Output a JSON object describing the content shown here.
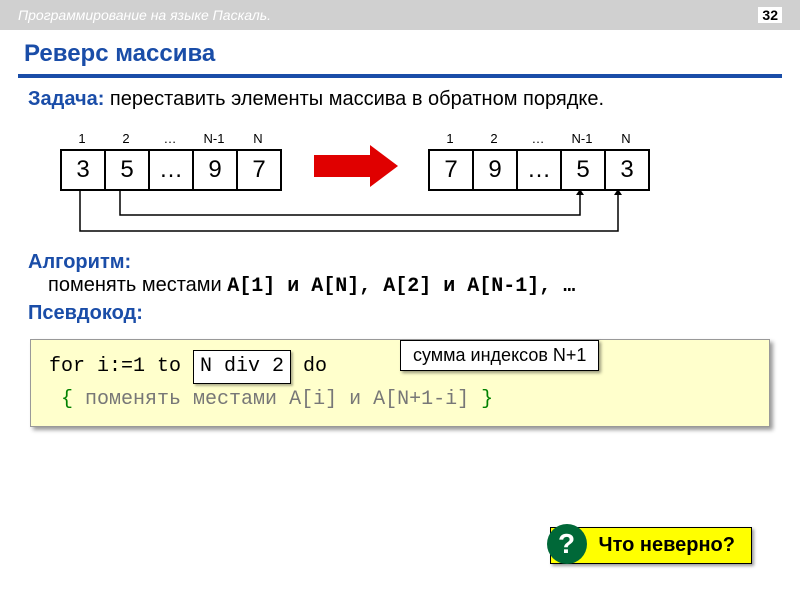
{
  "header": {
    "course": "Программирование на языке Паскаль.",
    "page": "32"
  },
  "title": "Реверс массива",
  "task": {
    "label": "Задача:",
    "text": " переставить элементы массива в обратном порядке."
  },
  "diagram": {
    "indices": [
      "1",
      "2",
      "…",
      "N-1",
      "N"
    ],
    "left": [
      "3",
      "5",
      "…",
      "9",
      "7"
    ],
    "right": [
      "7",
      "9",
      "…",
      "5",
      "3"
    ]
  },
  "algorithm": {
    "label": "Алгоритм:",
    "text_prefix": "поменять местами ",
    "text_mono": "A[1]  и A[N], A[2] и A[N-1], …"
  },
  "callout_sum": "сумма индексов N+1",
  "pseudo_label": "Псевдокод:",
  "code": {
    "line1_a": "for i:=1 to ",
    "line1_hl": "N div 2",
    "line1_b": " do",
    "line2_open": "{ ",
    "line2_body": "поменять местами A[i] и A[N+1-i]",
    "line2_close": " }"
  },
  "question": {
    "icon": "?",
    "text": "Что неверно?"
  }
}
